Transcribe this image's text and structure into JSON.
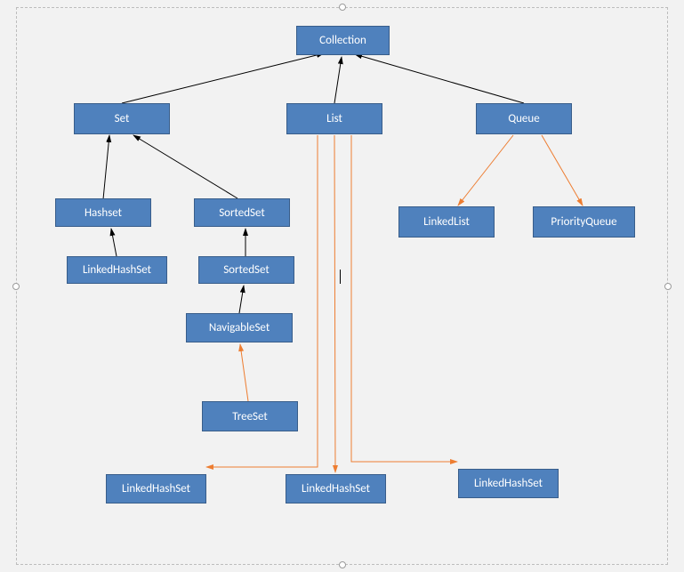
{
  "nodes": {
    "collection": "Collection",
    "set": "Set",
    "list": "List",
    "queue": "Queue",
    "hashset": "Hashset",
    "sortedset1": "SortedSet",
    "linkedlist": "LinkedList",
    "priorityqueue": "PriorityQueue",
    "linkedhashset1": "LinkedHashSet",
    "sortedset2": "SortedSet",
    "navigableset": "NavigableSet",
    "treeset": "TreeSet",
    "linkedhashset2": "LinkedHashSet",
    "linkedhashset3": "LinkedHashSet",
    "linkedhashset4": "LinkedHashSet"
  },
  "connectors": [
    {
      "from": "set",
      "to": "collection",
      "color": "black",
      "arrowAt": "to"
    },
    {
      "from": "list",
      "to": "collection",
      "color": "black",
      "arrowAt": "to"
    },
    {
      "from": "queue",
      "to": "collection",
      "color": "black",
      "arrowAt": "to"
    },
    {
      "from": "hashset",
      "to": "set",
      "color": "black",
      "arrowAt": "to"
    },
    {
      "from": "sortedset1",
      "to": "set",
      "color": "black",
      "arrowAt": "to"
    },
    {
      "from": "linkedhashset1",
      "to": "hashset",
      "color": "black",
      "arrowAt": "to"
    },
    {
      "from": "sortedset2",
      "to": "sortedset1",
      "color": "black",
      "arrowAt": "to"
    },
    {
      "from": "navigableset",
      "to": "sortedset2",
      "color": "black",
      "arrowAt": "to"
    },
    {
      "from": "queue",
      "to": "linkedlist",
      "color": "orange",
      "arrowAt": "to"
    },
    {
      "from": "queue",
      "to": "priorityqueue",
      "color": "orange",
      "arrowAt": "to"
    },
    {
      "from": "treeset",
      "to": "navigableset",
      "color": "orange",
      "arrowAt": "to"
    },
    {
      "from": "list",
      "to": "linkedhashset2",
      "color": "orange",
      "arrowAt": "to",
      "elbow": true
    },
    {
      "from": "list",
      "to": "linkedhashset3",
      "color": "orange",
      "arrowAt": "to"
    },
    {
      "from": "list",
      "to": "linkedhashset4",
      "color": "orange",
      "arrowAt": "to",
      "elbow": true
    }
  ]
}
